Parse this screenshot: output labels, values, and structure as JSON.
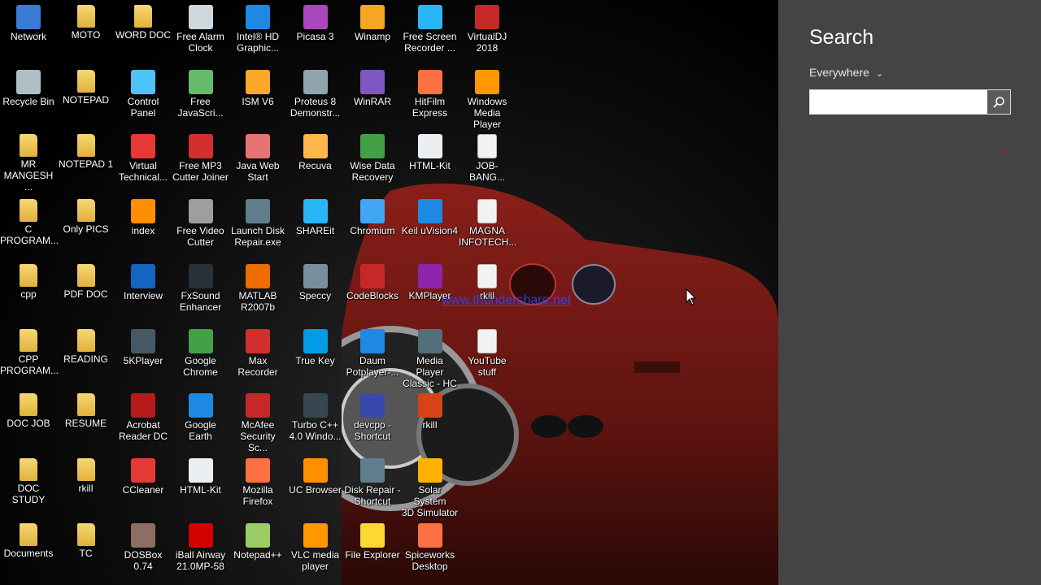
{
  "desktop": {
    "watermark": "www.thundershare.net",
    "icons": [
      {
        "label": "Network",
        "icon": "network-icon",
        "color": "#3a7bd5"
      },
      {
        "label": "MOTO",
        "icon": "folder-icon",
        "color": "#e8c04a"
      },
      {
        "label": "WORD DOC",
        "icon": "folder-icon",
        "color": "#e8c04a"
      },
      {
        "label": "Free Alarm\nClock",
        "icon": "alarm-clock-icon",
        "color": "#cfd8dc"
      },
      {
        "label": "Intel® HD\nGraphic...",
        "icon": "intel-graphics-icon",
        "color": "#1e88e5"
      },
      {
        "label": "Picasa 3",
        "icon": "picasa-icon",
        "color": "#ab47bc"
      },
      {
        "label": "Winamp",
        "icon": "winamp-icon",
        "color": "#f5a623"
      },
      {
        "label": "Free Screen\nRecorder ...",
        "icon": "screen-recorder-icon",
        "color": "#29b6f6"
      },
      {
        "label": "VirtualDJ\n2018",
        "icon": "virtualdj-icon",
        "color": "#c62828"
      },
      {
        "label": "Recycle Bin",
        "icon": "recycle-bin-icon",
        "color": "#b0bec5"
      },
      {
        "label": "NOTEPAD",
        "icon": "folder-icon",
        "color": "#e8c04a"
      },
      {
        "label": "Control\nPanel",
        "icon": "control-panel-icon",
        "color": "#4fc3f7"
      },
      {
        "label": "Free\nJavaScri...",
        "icon": "javascript-icon",
        "color": "#66bb6a"
      },
      {
        "label": "ISM V6",
        "icon": "ism-icon",
        "color": "#ffa726"
      },
      {
        "label": "Proteus 8\nDemonstr...",
        "icon": "proteus-icon",
        "color": "#90a4ae"
      },
      {
        "label": "WinRAR",
        "icon": "winrar-icon",
        "color": "#7e57c2"
      },
      {
        "label": "HitFilm\nExpress",
        "icon": "hitfilm-icon",
        "color": "#ff7043"
      },
      {
        "label": "Windows\nMedia Player",
        "icon": "media-player-icon",
        "color": "#ff9800"
      },
      {
        "label": "MR\nMANGESH ...",
        "icon": "folder-icon",
        "color": "#e8c04a"
      },
      {
        "label": "NOTEPAD 1",
        "icon": "folder-icon",
        "color": "#e8c04a"
      },
      {
        "label": "Virtual\nTechnical...",
        "icon": "pdf-icon",
        "color": "#e53935"
      },
      {
        "label": "Free MP3\nCutter Joiner",
        "icon": "mp3-cutter-icon",
        "color": "#d32f2f"
      },
      {
        "label": "Java Web\nStart",
        "icon": "java-icon",
        "color": "#e57373"
      },
      {
        "label": "Recuva",
        "icon": "recuva-icon",
        "color": "#ffb74d"
      },
      {
        "label": "Wise Data\nRecovery",
        "icon": "wise-recovery-icon",
        "color": "#43a047"
      },
      {
        "label": "HTML-Kit",
        "icon": "html-kit-icon",
        "color": "#eceff1"
      },
      {
        "label": "JOB-BANG...",
        "icon": "document-icon",
        "color": "#f5f5f5"
      },
      {
        "label": "C\nPROGRAM...",
        "icon": "folder-icon",
        "color": "#e8c04a"
      },
      {
        "label": "Only PICS",
        "icon": "folder-icon",
        "color": "#e8c04a"
      },
      {
        "label": "index",
        "icon": "uc-browser-icon",
        "color": "#ff8f00"
      },
      {
        "label": "Free Video\nCutter",
        "icon": "video-cutter-icon",
        "color": "#9e9e9e"
      },
      {
        "label": "Launch Disk\nRepair.exe",
        "icon": "disk-repair-icon",
        "color": "#607d8b"
      },
      {
        "label": "SHAREit",
        "icon": "shareit-icon",
        "color": "#29b6f6"
      },
      {
        "label": "Chromium",
        "icon": "chromium-icon",
        "color": "#42a5f5"
      },
      {
        "label": "Keil uVision4",
        "icon": "keil-icon",
        "color": "#1e88e5"
      },
      {
        "label": "MAGNA\nINFOTECH...",
        "icon": "document-icon",
        "color": "#f5f5f5"
      },
      {
        "label": "cpp",
        "icon": "folder-icon",
        "color": "#e8c04a"
      },
      {
        "label": "PDF DOC",
        "icon": "folder-icon",
        "color": "#e8c04a"
      },
      {
        "label": "Interview",
        "icon": "word-icon",
        "color": "#1565c0"
      },
      {
        "label": "FxSound\nEnhancer",
        "icon": "fxsound-icon",
        "color": "#263238"
      },
      {
        "label": "MATLAB\nR2007b",
        "icon": "matlab-icon",
        "color": "#ef6c00"
      },
      {
        "label": "Speccy",
        "icon": "speccy-icon",
        "color": "#78909c"
      },
      {
        "label": "CodeBlocks",
        "icon": "codeblocks-icon",
        "color": "#c62828"
      },
      {
        "label": "KMPlayer",
        "icon": "kmplayer-icon",
        "color": "#8e24aa"
      },
      {
        "label": "rkill",
        "icon": "document-icon",
        "color": "#f5f5f5"
      },
      {
        "label": "CPP\nPROGRAM...",
        "icon": "folder-icon",
        "color": "#e8c04a"
      },
      {
        "label": "READING",
        "icon": "folder-icon",
        "color": "#e8c04a"
      },
      {
        "label": "5KPlayer",
        "icon": "5kplayer-icon",
        "color": "#455a64"
      },
      {
        "label": "Google\nChrome",
        "icon": "chrome-icon",
        "color": "#43a047"
      },
      {
        "label": "Max\nRecorder",
        "icon": "max-recorder-icon",
        "color": "#d32f2f"
      },
      {
        "label": "True Key",
        "icon": "true-key-icon",
        "color": "#039be5"
      },
      {
        "label": "Daum\nPotplayer-...",
        "icon": "potplayer-icon",
        "color": "#1e88e5"
      },
      {
        "label": "Media Player\nClassic - HC",
        "icon": "mpc-icon",
        "color": "#546e7a"
      },
      {
        "label": "YouTube\nstuff",
        "icon": "document-icon",
        "color": "#f5f5f5"
      },
      {
        "label": "DOC JOB",
        "icon": "folder-icon",
        "color": "#e8c04a"
      },
      {
        "label": "RESUME",
        "icon": "folder-icon",
        "color": "#e8c04a"
      },
      {
        "label": "Acrobat\nReader DC",
        "icon": "acrobat-icon",
        "color": "#b71c1c"
      },
      {
        "label": "Google Earth",
        "icon": "google-earth-icon",
        "color": "#1e88e5"
      },
      {
        "label": "McAfee\nSecurity Sc...",
        "icon": "mcafee-icon",
        "color": "#c62828"
      },
      {
        "label": "Turbo C++\n4.0 Windo...",
        "icon": "turbo-cpp-icon",
        "color": "#37474f"
      },
      {
        "label": "devcpp -\nShortcut",
        "icon": "devcpp-icon",
        "color": "#3949ab"
      },
      {
        "label": "rkill",
        "icon": "rkill-icon",
        "color": "#d84315"
      },
      {
        "label": "DOC STUDY",
        "icon": "folder-icon",
        "color": "#e8c04a"
      },
      {
        "label": "rkill",
        "icon": "folder-icon",
        "color": "#e8c04a"
      },
      {
        "label": "CCleaner",
        "icon": "ccleaner-icon",
        "color": "#e53935"
      },
      {
        "label": "HTML-Kit",
        "icon": "html-kit-icon",
        "color": "#eceff1"
      },
      {
        "label": "Mozilla\nFirefox",
        "icon": "firefox-icon",
        "color": "#ff7043"
      },
      {
        "label": "UC Browser",
        "icon": "uc-browser-icon",
        "color": "#ff8f00"
      },
      {
        "label": "Disk Repair -\nShortcut",
        "icon": "disk-repair-icon",
        "color": "#607d8b"
      },
      {
        "label": "Solar System\n3D Simulator",
        "icon": "solar-system-icon",
        "color": "#ffb300"
      },
      {
        "label": "Documents",
        "icon": "folder-icon",
        "color": "#e8c04a"
      },
      {
        "label": "TC",
        "icon": "folder-icon",
        "color": "#e8c04a"
      },
      {
        "label": "DOSBox 0.74",
        "icon": "dosbox-icon",
        "color": "#8d6e63"
      },
      {
        "label": "iBall Airway\n21.0MP-58",
        "icon": "iball-icon",
        "color": "#d50000"
      },
      {
        "label": "Notepad++",
        "icon": "notepadpp-icon",
        "color": "#9ccc65"
      },
      {
        "label": "VLC media\nplayer",
        "icon": "vlc-icon",
        "color": "#ff9800"
      },
      {
        "label": "File Explorer",
        "icon": "file-explorer-icon",
        "color": "#fdd835"
      },
      {
        "label": "Spiceworks\nDesktop",
        "icon": "spiceworks-icon",
        "color": "#ff7043"
      }
    ]
  },
  "search": {
    "title": "Search",
    "scope": "Everywhere",
    "input_value": "",
    "pane_color": "#444444"
  }
}
